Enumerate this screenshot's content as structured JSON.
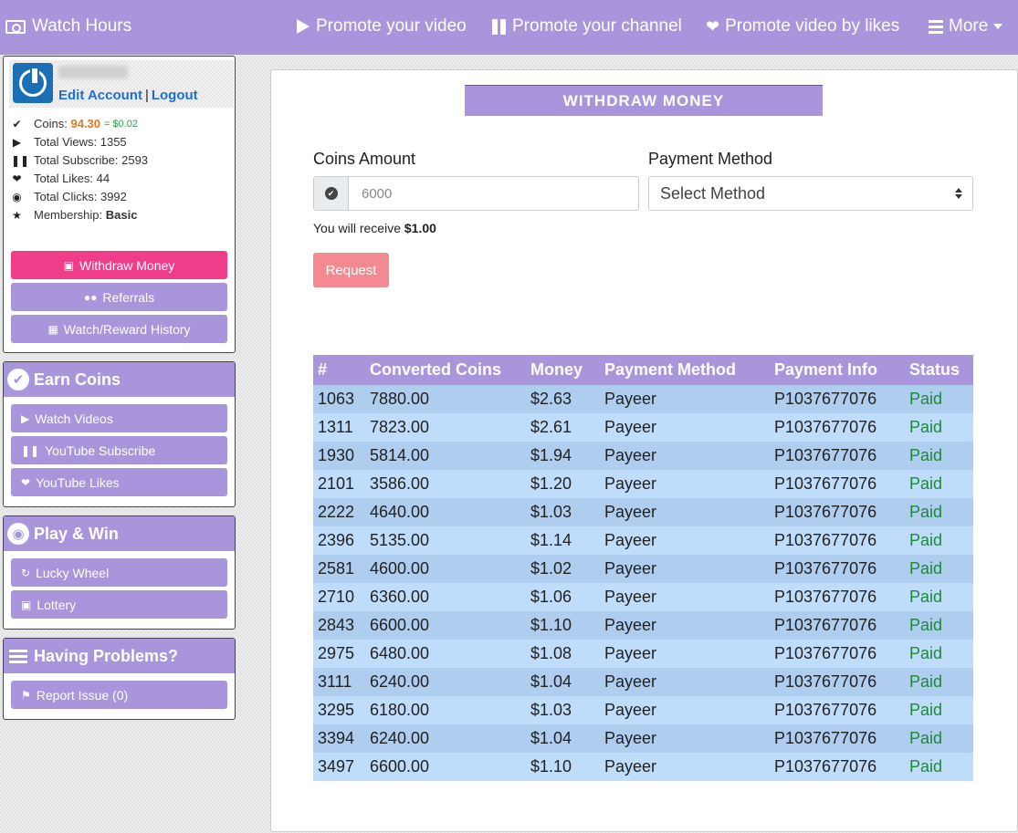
{
  "nav": {
    "brand": "Watch Hours",
    "items": [
      "Promote your video",
      "Promote your channel",
      "Promote video by likes",
      "More"
    ]
  },
  "profile": {
    "edit_account": "Edit Account",
    "separator": "|",
    "logout": "Logout",
    "coins_label": "Coins:",
    "coins_value": "94.30",
    "coins_equiv": "= $0.02",
    "total_views": "Total Views: 1355",
    "total_subscribe": "Total Subscribe: 2593",
    "total_likes": "Total Likes: 44",
    "total_clicks": "Total Clicks: 3992",
    "membership_label": "Membership:",
    "membership_value": "Basic",
    "buttons": [
      "Withdraw Money",
      "Referrals",
      "Watch/Reward History"
    ]
  },
  "earn": {
    "title": "Earn Coins",
    "items": [
      "Watch Videos",
      "YouTube Subscribe",
      "YouTube Likes"
    ]
  },
  "play": {
    "title": "Play & Win",
    "items": [
      "Lucky Wheel",
      "Lottery"
    ]
  },
  "problems": {
    "title": "Having Problems?",
    "items": [
      "Report Issue (0)"
    ]
  },
  "withdraw": {
    "title": "WITHDRAW MONEY",
    "coins_label": "Coins Amount",
    "coins_placeholder": "6000",
    "method_label": "Payment Method",
    "method_selected": "Select Method",
    "receive_text": "You will receive",
    "receive_amount": "$1.00",
    "request_button": "Request"
  },
  "history": {
    "headers": [
      "#",
      "Converted Coins",
      "Money",
      "Payment Method",
      "Payment Info",
      "Status"
    ],
    "rows": [
      [
        "1063",
        "7880.00",
        "$2.63",
        "Payeer",
        "P1037677076",
        "Paid"
      ],
      [
        "1311",
        "7823.00",
        "$2.61",
        "Payeer",
        "P1037677076",
        "Paid"
      ],
      [
        "1930",
        "5814.00",
        "$1.94",
        "Payeer",
        "P1037677076",
        "Paid"
      ],
      [
        "2101",
        "3586.00",
        "$1.20",
        "Payeer",
        "P1037677076",
        "Paid"
      ],
      [
        "2222",
        "4640.00",
        "$1.03",
        "Payeer",
        "P1037677076",
        "Paid"
      ],
      [
        "2396",
        "5135.00",
        "$1.14",
        "Payeer",
        "P1037677076",
        "Paid"
      ],
      [
        "2581",
        "4600.00",
        "$1.02",
        "Payeer",
        "P1037677076",
        "Paid"
      ],
      [
        "2710",
        "6360.00",
        "$1.06",
        "Payeer",
        "P1037677076",
        "Paid"
      ],
      [
        "2843",
        "6600.00",
        "$1.10",
        "Payeer",
        "P1037677076",
        "Paid"
      ],
      [
        "2975",
        "6480.00",
        "$1.08",
        "Payeer",
        "P1037677076",
        "Paid"
      ],
      [
        "3111",
        "6240.00",
        "$1.04",
        "Payeer",
        "P1037677076",
        "Paid"
      ],
      [
        "3295",
        "6180.00",
        "$1.03",
        "Payeer",
        "P1037677076",
        "Paid"
      ],
      [
        "3394",
        "6240.00",
        "$1.04",
        "Payeer",
        "P1037677076",
        "Paid"
      ],
      [
        "3497",
        "6600.00",
        "$1.10",
        "Payeer",
        "P1037677076",
        "Paid"
      ]
    ]
  },
  "colors": {
    "accent": "#a995dc",
    "pink": "#ef3d8a",
    "request": "#f38a91",
    "paid": "#1d8a38",
    "coins": "#e8781a"
  }
}
